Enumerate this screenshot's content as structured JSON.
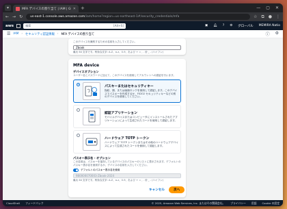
{
  "browser": {
    "tab_title": "MFA デバイスの割り当て | IAM | Glo...",
    "url_host": "us-east-1.console.aws.amazon.com",
    "url_rest": "/iam/home?region=us-northeast-1#/security_credentials/mfa"
  },
  "aws_nav": {
    "logo": "aws",
    "search_placeholder": "検索",
    "search_shortcut": "[Alt+S]",
    "region": "グローバル",
    "account": "MEMIRA Natio"
  },
  "breadcrumb": {
    "items": [
      "IAM",
      "セキュリティ認証情報",
      "MFA デバイスの割り当て"
    ]
  },
  "device_name": {
    "help": "このデバイスを識別するための名前を入力してください。",
    "value": "Zbook",
    "hint": "最大 64 文字です。有効な文字: A-Z、a-z、0-9、および + = , . @ _ - (ハイフン)"
  },
  "mfa": {
    "title": "MFA device",
    "subtitle": "デバイスオプション",
    "desc": "ユーザー名とパスワードに加えて、このデバイスを使用してアカウントへの認証を行います。",
    "options": [
      {
        "title": "パスキーまたはセキュリティキー",
        "desc": "指紋、顔、または画面ロックを使用して認証します。このデバイスでパスキーを作成するか、FIDO2 セキュリティキーなどの別のデバイスを使用してください。",
        "icon": "passkey-icon",
        "selected": true
      },
      {
        "title": "認証アプリケーション",
        "desc": "モバイルデバイスまたはコンピュータにインストールされたアプリケーションによって生成されたコードを使用して認証します。",
        "icon": "authenticator-app-icon",
        "selected": false
      },
      {
        "title": "ハードウェア TOTP トークン",
        "desc": "ハードウェア TOTP トークンまたはその他のハードウェアデバイスによって生成されたコードを使用して認証します。",
        "icon": "hardware-token-icon",
        "selected": false
      }
    ]
  },
  "passkey_display": {
    "title": "パスキー表示名 - オプション",
    "desc": "この名前は、パスキーを保存しているデバイスのパスキーのリストに表示されます。デフォルトのパスキー表示名を使用するか、デバイスの名前を入力してください。",
    "toggle_label": "デフォルトのパスキー表示名を使用",
    "toggle_on": true,
    "value": "980000070003-Zbook-2024",
    "hint": "最大 64 文字です。有効な文字: A-Z、a-z、0-9、および + = , . @ _ - (ハイフン)"
  },
  "actions": {
    "cancel": "キャンセル",
    "next": "次へ"
  },
  "footer": {
    "cloudshell": "CloudShell",
    "feedback": "フィードバック",
    "copyright": "© 2025, Amazon Web Services, Inc. またはその関連会社。",
    "privacy": "プライバシー",
    "terms": "用語",
    "cookie": "Cookie の設定"
  },
  "colors": {
    "accent": "#0972d3",
    "primary_button": "#ff9900",
    "nav_bg": "#0f1b2a"
  }
}
